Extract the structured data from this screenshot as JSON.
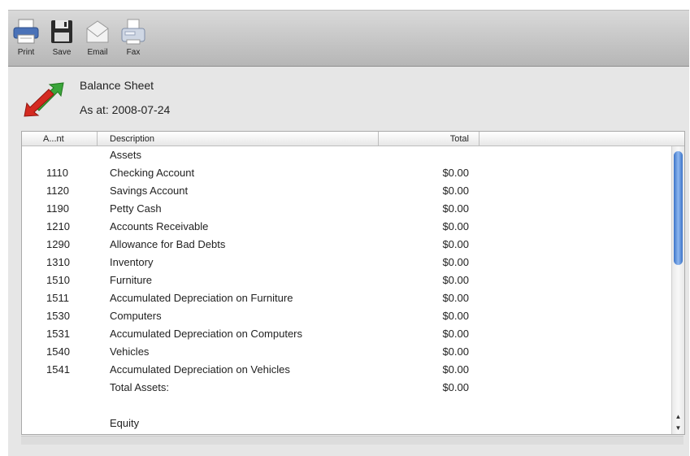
{
  "toolbar": {
    "buttons": [
      {
        "label": "Print",
        "icon": "printer-icon"
      },
      {
        "label": "Save",
        "icon": "floppy-disk-icon"
      },
      {
        "label": "Email",
        "icon": "envelope-icon"
      },
      {
        "label": "Fax",
        "icon": "fax-machine-icon"
      }
    ]
  },
  "report": {
    "title": "Balance Sheet",
    "as_at": "As at: 2008-07-24",
    "columns": [
      "A...nt",
      "Description",
      "Total"
    ],
    "rows": [
      {
        "account": "",
        "description": "Assets",
        "total": ""
      },
      {
        "account": "1110",
        "description": "Checking Account",
        "total": "$0.00"
      },
      {
        "account": "1120",
        "description": "Savings Account",
        "total": "$0.00"
      },
      {
        "account": "1190",
        "description": "Petty Cash",
        "total": "$0.00"
      },
      {
        "account": "1210",
        "description": "Accounts Receivable",
        "total": "$0.00"
      },
      {
        "account": "1290",
        "description": "Allowance for Bad Debts",
        "total": "$0.00"
      },
      {
        "account": "1310",
        "description": "Inventory",
        "total": "$0.00"
      },
      {
        "account": "1510",
        "description": "Furniture",
        "total": "$0.00"
      },
      {
        "account": "1511",
        "description": "Accumulated Depreciation on Furniture",
        "total": "$0.00"
      },
      {
        "account": "1530",
        "description": "Computers",
        "total": "$0.00"
      },
      {
        "account": "1531",
        "description": "Accumulated Depreciation on Computers",
        "total": "$0.00"
      },
      {
        "account": "1540",
        "description": "Vehicles",
        "total": "$0.00"
      },
      {
        "account": "1541",
        "description": "Accumulated Depreciation on Vehicles",
        "total": "$0.00"
      },
      {
        "account": "",
        "description": "Total Assets:",
        "total": "$0.00"
      },
      {
        "account": "",
        "description": "",
        "total": ""
      },
      {
        "account": "",
        "description": "Equity",
        "total": ""
      }
    ]
  },
  "colors": {
    "scroll_thumb": "#3b74c8",
    "logo_green": "#3aa53a",
    "logo_red": "#d42a20"
  }
}
